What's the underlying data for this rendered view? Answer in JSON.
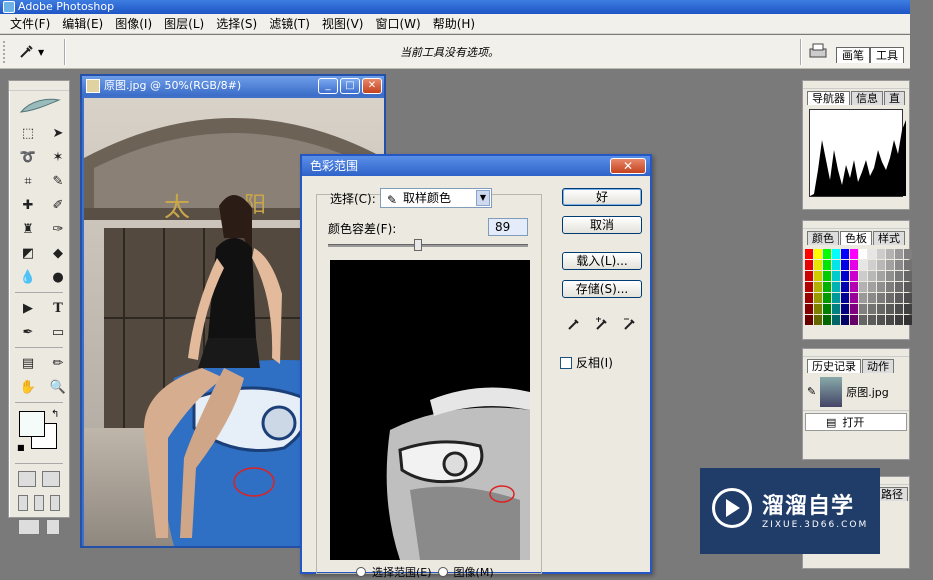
{
  "app": {
    "title": "Adobe Photoshop"
  },
  "menu": [
    "文件(F)",
    "编辑(E)",
    "图像(I)",
    "图层(L)",
    "选择(S)",
    "滤镜(T)",
    "视图(V)",
    "窗口(W)",
    "帮助(H)"
  ],
  "options": {
    "message": "当前工具没有选项。",
    "right_tabs": [
      "画笔",
      "工具"
    ]
  },
  "document": {
    "title": "原图.jpg @ 50%(RGB/8#)"
  },
  "dialog": {
    "title": "色彩范围",
    "select_label": "选择(C):",
    "select_value": "取样颜色",
    "fuzziness_label": "颜色容差(F):",
    "fuzziness_value": "89",
    "fuzziness_level": 0.45,
    "buttons": {
      "ok": "好",
      "cancel": "取消",
      "load": "载入(L)...",
      "save": "存储(S)..."
    },
    "invert_label": "反相(I)",
    "radio_selection": "选择范围(E)",
    "radio_image": "图像(M)"
  },
  "panels": {
    "navigator_tabs": [
      "导航器",
      "信息",
      "直"
    ],
    "color_tabs": [
      "颜色",
      "色板",
      "样式"
    ],
    "history_tabs": [
      "历史记录",
      "动作"
    ],
    "history_snapshot": "原图.jpg",
    "history_step": "打开",
    "layers_tab": "路径"
  },
  "watermark": {
    "brand": "溜溜自学",
    "url": "ZIXUE.3D66.COM"
  }
}
